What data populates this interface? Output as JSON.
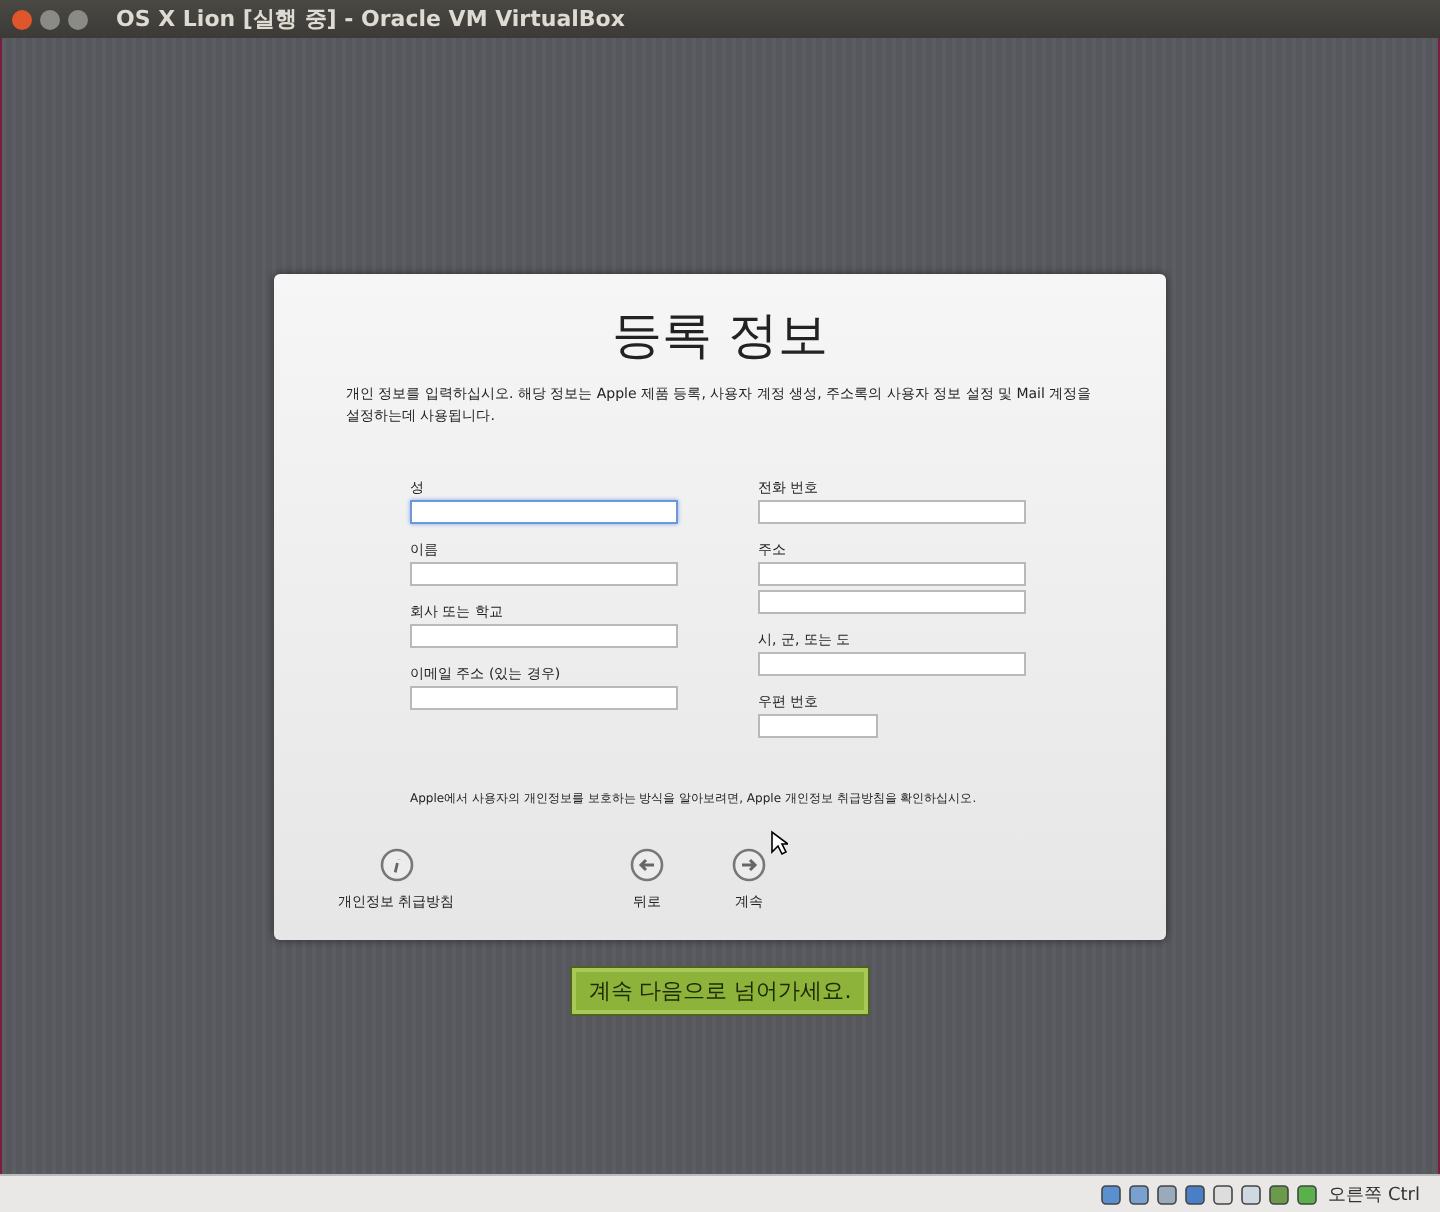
{
  "window": {
    "title": "OS X Lion [실행 중] - Oracle VM VirtualBox"
  },
  "dialog": {
    "title": "등록 정보",
    "intro": "개인 정보를 입력하십시오. 해당 정보는 Apple 제품 등록, 사용자 계정 생성, 주소록의 사용자 정보 설정 및 Mail 계정을 설정하는데 사용됩니다.",
    "left_fields": [
      {
        "label": "성",
        "kind": "single",
        "focused": true
      },
      {
        "label": "이름",
        "kind": "single",
        "focused": false
      },
      {
        "label": "회사 또는 학교",
        "kind": "single",
        "focused": false
      },
      {
        "label": "이메일 주소 (있는 경우)",
        "kind": "single",
        "focused": false
      }
    ],
    "right_fields": [
      {
        "label": "전화 번호",
        "kind": "single",
        "focused": false
      },
      {
        "label": "주소",
        "kind": "double",
        "focused": false
      },
      {
        "label": "시, 군, 또는 도",
        "kind": "single",
        "focused": false
      },
      {
        "label": "우편 번호",
        "kind": "short",
        "focused": false
      }
    ],
    "privacy_note": "Apple에서 사용자의 개인정보를 보호하는 방식을 알아보려면, Apple 개인정보 취급방침을 확인하십시오.",
    "buttons": [
      {
        "label": "개인정보 취급방침",
        "kind": "info"
      },
      {
        "label": "뒤로",
        "kind": "back"
      },
      {
        "label": "계속",
        "kind": "next"
      }
    ]
  },
  "caption": "계속 다음으로 넘어가세요.",
  "status_bar": {
    "host_key": "오른쪽 Ctrl"
  }
}
